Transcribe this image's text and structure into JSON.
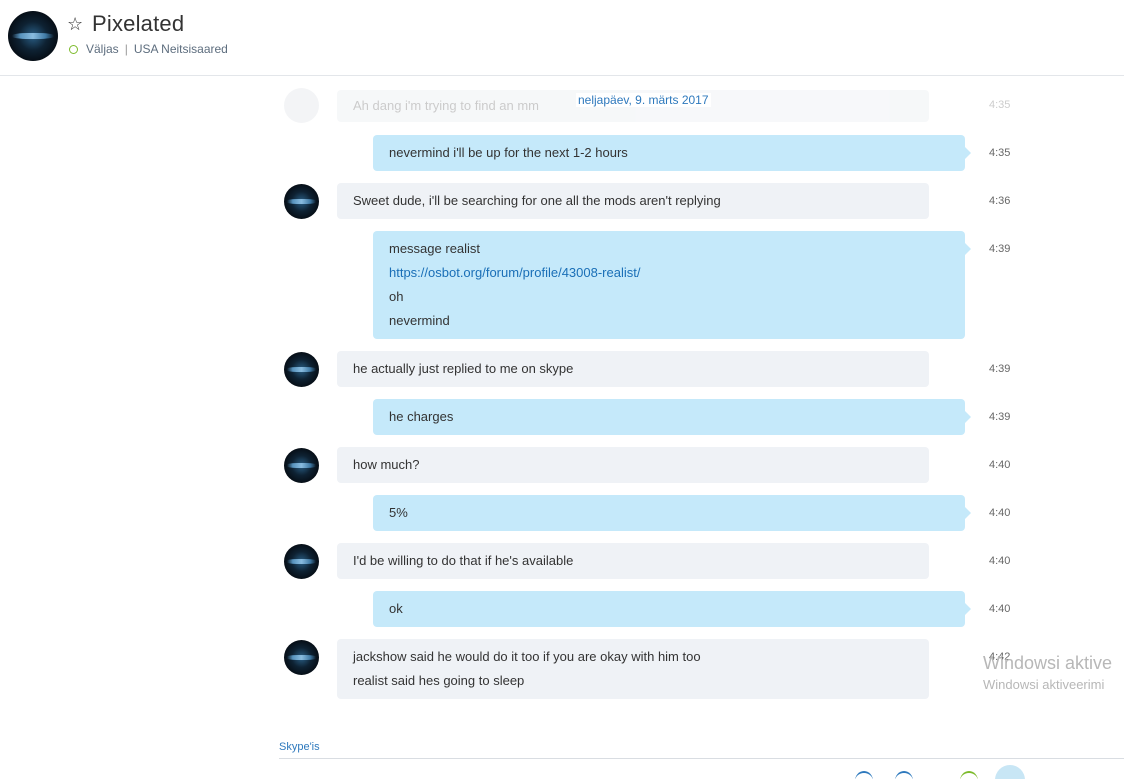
{
  "header": {
    "title": "Pixelated",
    "status": "Väljas",
    "separator": "|",
    "location": "USA Neitsisaared"
  },
  "chat": {
    "date_separator": "neljapäev, 9. märts 2017",
    "faded_message": {
      "text": "Ah dang i'm trying to find an mm",
      "time": "4:35"
    },
    "messages": [
      {
        "side": "out",
        "lines": [
          "nevermind i'll be up for the next 1-2 hours"
        ],
        "time": "4:35"
      },
      {
        "side": "in",
        "lines": [
          "Sweet dude, i'll be searching for one all the mods aren't replying"
        ],
        "time": "4:36"
      },
      {
        "side": "out",
        "lines": [
          "message realist",
          "https://osbot.org/forum/profile/43008-realist/",
          "oh",
          "nevermind"
        ],
        "time": "4:39"
      },
      {
        "side": "in",
        "lines": [
          "he actually just replied to me on skype"
        ],
        "time": "4:39"
      },
      {
        "side": "out",
        "lines": [
          "he charges"
        ],
        "time": "4:39"
      },
      {
        "side": "in",
        "lines": [
          "how much?"
        ],
        "time": "4:40"
      },
      {
        "side": "out",
        "lines": [
          "5%"
        ],
        "time": "4:40"
      },
      {
        "side": "in",
        "lines": [
          "I'd be willing to do that if he's available"
        ],
        "time": "4:40"
      },
      {
        "side": "out",
        "lines": [
          "ok"
        ],
        "time": "4:40"
      },
      {
        "side": "in",
        "lines": [
          "jackshow said he would do it too if you are okay with him too",
          "realist said hes going to sleep"
        ],
        "time": "4:42"
      }
    ]
  },
  "composer": {
    "label": "Skype'is"
  },
  "watermark": {
    "line1": "Windowsi aktive",
    "line2": "Windowsi aktiveerimi"
  },
  "colors": {
    "incoming_bubble": "#eff2f6",
    "outgoing_bubble": "#c5e9fa",
    "link": "#1a6fb7",
    "online_ring": "#7dbb2c"
  }
}
